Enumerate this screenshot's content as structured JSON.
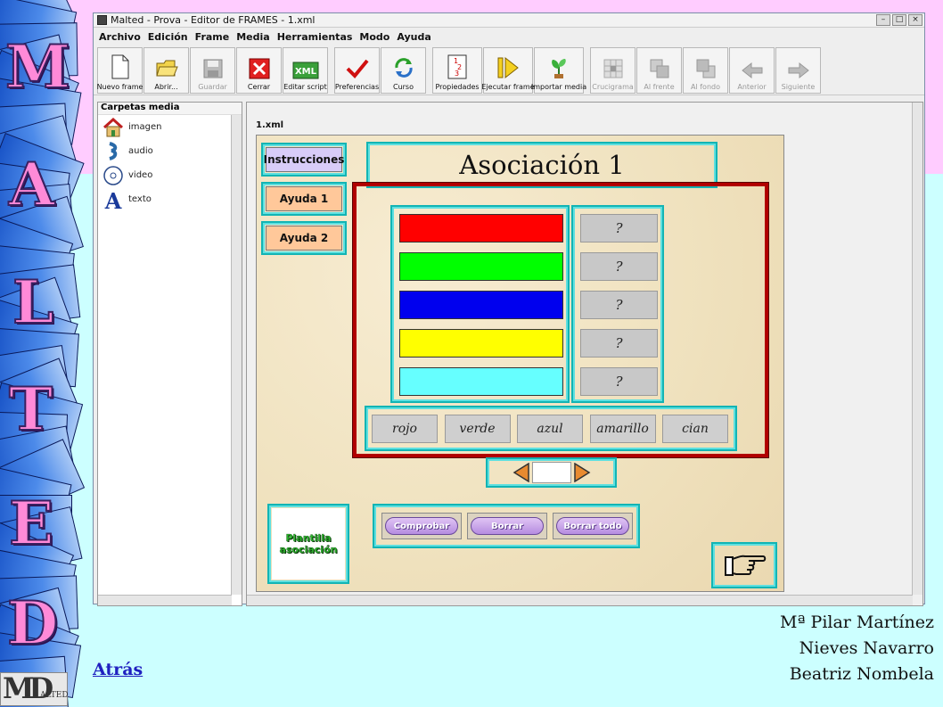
{
  "slide": {
    "letters": [
      "M",
      "A",
      "L",
      "T",
      "E",
      "D"
    ],
    "logo_big": "MD",
    "logo_small": "ALTED",
    "back_link": "Atrás",
    "authors": [
      "Mª Pilar Martínez",
      "Nieves Navarro",
      "Beatriz Nombela"
    ]
  },
  "window": {
    "title": "Malted - Prova - Editor de FRAMES - 1.xml",
    "menu": [
      "Archivo",
      "Edición",
      "Frame",
      "Media",
      "Herramientas",
      "Modo",
      "Ayuda"
    ],
    "toolbar": {
      "nuevo_frame": "Nuevo frame",
      "abrir": "Abrir...",
      "guardar": "Guardar",
      "cerrar": "Cerrar",
      "editar_script": "Editar script",
      "preferencias": "Preferencias",
      "curso": "Curso",
      "propiedades": "Propiedades",
      "ejecutar_frame": "Ejecutar frame",
      "importar_media": "Importar media",
      "crucigrama": "Crucigrama",
      "al_frente": "Al frente",
      "al_fondo": "Al fondo",
      "anterior": "Anterior",
      "siguiente": "Siguiente"
    },
    "media_panel": {
      "title": "Carpetas media",
      "items": [
        "imagen",
        "audio",
        "video",
        "texto"
      ]
    },
    "editor": {
      "tab": "1.xml",
      "instrucciones": "Instrucciones",
      "ayuda1": "Ayuda 1",
      "ayuda2": "Ayuda 2",
      "title": "Asociación 1",
      "color_bars": [
        "#ff0000",
        "#00ff00",
        "#0000ee",
        "#ffff00",
        "#66ffff"
      ],
      "question_mark": "?",
      "words": [
        "rojo",
        "verde",
        "azul",
        "amarillo",
        "cian"
      ],
      "plantilla_line1": "Plantilla",
      "plantilla_line2": "asociación",
      "buttons": {
        "comprobar": "Comprobar",
        "borrar": "Borrar",
        "borrar_todo": "Borrar todo"
      }
    }
  },
  "colors": {
    "top_bg": "#ffccff",
    "bottom_bg": "#ccffff",
    "accent_cyan": "#12b4b4",
    "frame_red": "#b10000"
  }
}
